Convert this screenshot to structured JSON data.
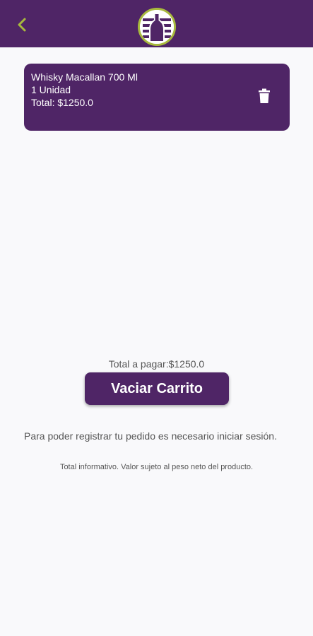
{
  "colors": {
    "brand_purple": "#4f2566",
    "accent_green": "#a8b93d",
    "background": "#f9f9fb",
    "text_gray": "#555555"
  },
  "header": {
    "back_icon": "chevron-left-icon",
    "logo_icon": "bottle-logo-icon"
  },
  "cart": {
    "items": [
      {
        "name": "Whisky Macallan 700 Ml",
        "quantity": "1 Unidad",
        "total": "Total: $1250.0",
        "delete_icon": "trash-icon"
      }
    ]
  },
  "summary": {
    "total_to_pay": "Total a pagar:$1250.0",
    "empty_cart_label": "Vaciar Carrito",
    "login_notice": "Para poder registrar tu pedido es necesario iniciar sesión.",
    "info_notice": "Total informativo. Valor sujeto al peso neto del producto."
  }
}
